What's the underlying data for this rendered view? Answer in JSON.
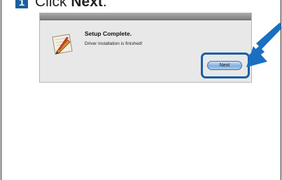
{
  "step": {
    "number": "1",
    "prefix": "Click ",
    "action": "Next",
    "suffix": "."
  },
  "dialog": {
    "title": "Setup Complete.",
    "message": "Driver installation is finished!",
    "next_label": "Next",
    "icon": "installer-icon"
  },
  "annotation": {
    "arrow_icon": "pointer-arrow-icon",
    "highlight_color": "#1a5fa6"
  }
}
